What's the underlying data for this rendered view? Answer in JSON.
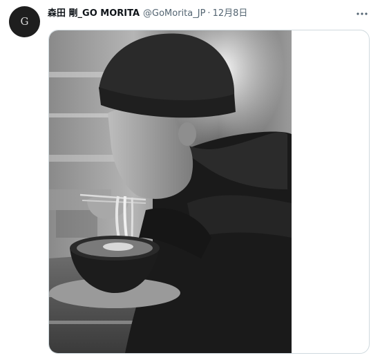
{
  "tweet": {
    "avatar_letter": "G",
    "display_name": "森田 剛_GO MORITA",
    "handle": "@GoMorita_JP",
    "separator": "·",
    "date": "12月8日"
  },
  "icons": {
    "more": "more-horizontal-icon",
    "avatar": "avatar-logo"
  },
  "media": {
    "description_kind": "black-and-white photo"
  },
  "colors": {
    "name": "#0f1419",
    "secondary": "#536471",
    "border": "#cfd9de"
  }
}
